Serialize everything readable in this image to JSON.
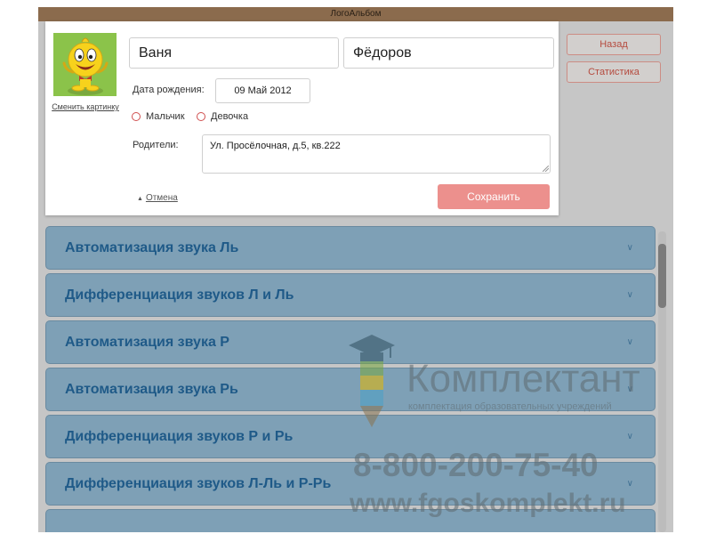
{
  "window": {
    "title": "ЛогоАльбом"
  },
  "side_buttons": {
    "back": "Назад",
    "statistics": "Статистика"
  },
  "dialog": {
    "change_picture": "Сменить картинку",
    "first_name": "Ваня",
    "last_name": "Фёдоров",
    "birthdate_label": "Дата рождения:",
    "birthdate": "09 Май 2012",
    "gender_options": [
      "Мальчик",
      "Девочка"
    ],
    "parents_label": "Родители:",
    "parents_value": "Ул. Просёлочная, д.5, кв.222",
    "cancel": "Отмена",
    "save": "Сохранить"
  },
  "sections": [
    "Автоматизация звука Ль",
    "Дифференциация звуков Л и Ль",
    "Автоматизация звука Р",
    "Автоматизация звука Рь",
    "Дифференциация звуков Р и Рь",
    "Дифференциация звуков Л-Ль и Р-Рь"
  ],
  "watermark": {
    "brand": "Комплектант",
    "tagline": "комплектация образовательных учреждений",
    "phone": "8-800-200-75-40",
    "site": "www.fgoskomplekt.ru"
  },
  "icons": {
    "avatar": "smiley-character-icon",
    "section_toggle": "chevron-down-icon",
    "cancel_caret": "caret-up-icon"
  },
  "colors": {
    "title_bar": "#8b6b4d",
    "accordion_fill": "#7ea0b6",
    "accordion_text": "#1f5a88",
    "save_button": "#ec908d",
    "side_button_text": "#b54a3e"
  }
}
